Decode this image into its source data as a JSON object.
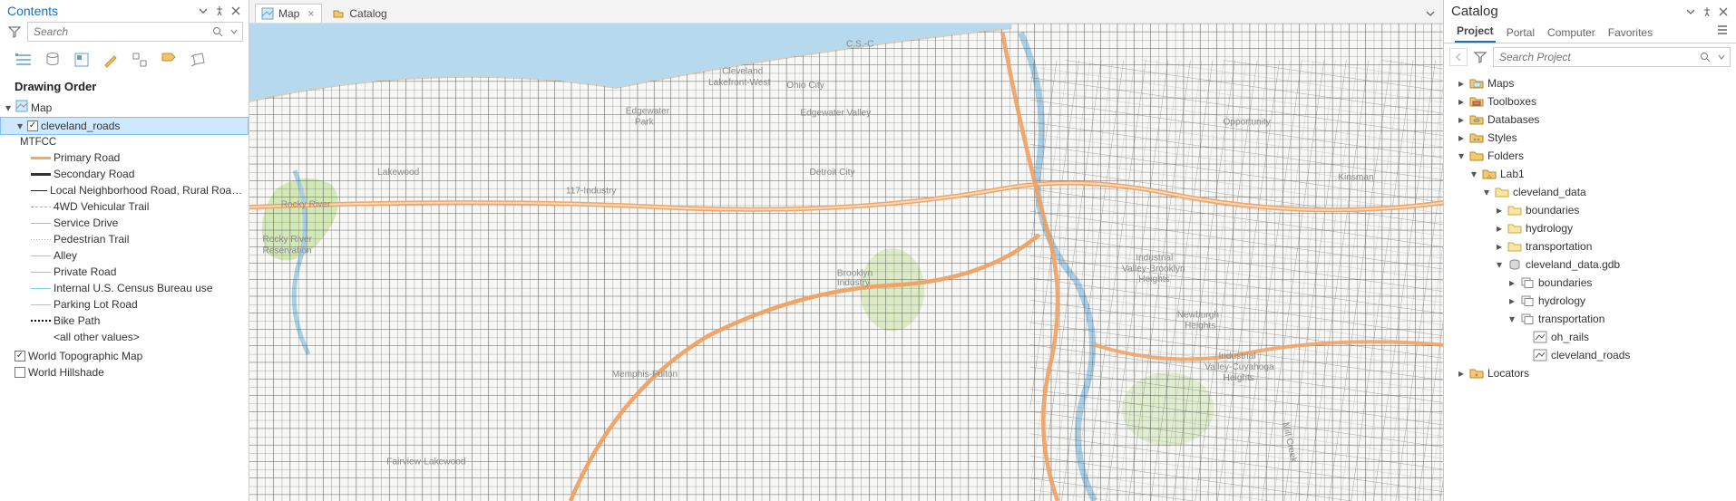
{
  "contents": {
    "title": "Contents",
    "search_placeholder": "Search",
    "section_title": "Drawing Order",
    "map_label": "Map",
    "selected_layer": "cleveland_roads",
    "mtfcc_label": "MTFCC",
    "legend_items": [
      {
        "swatch": "solid-orange",
        "label": "Primary Road"
      },
      {
        "swatch": "solid-dark",
        "label": "Secondary Road"
      },
      {
        "swatch": "thin-dark",
        "label": "Local Neighborhood Road, Rural Road, City Str..."
      },
      {
        "swatch": "dash-gray",
        "label": "4WD Vehicular Trail"
      },
      {
        "swatch": "thin-gray",
        "label": "Service Drive"
      },
      {
        "swatch": "dot-gray",
        "label": "Pedestrian Trail"
      },
      {
        "swatch": "thin-gray",
        "label": "Alley"
      },
      {
        "swatch": "thin-gray",
        "label": "Private Road"
      },
      {
        "swatch": "cyan",
        "label": "Internal U.S. Census Bureau use"
      },
      {
        "swatch": "thin-gray",
        "label": "Parking Lot Road"
      },
      {
        "swatch": "dark-dot",
        "label": "Bike Path"
      }
    ],
    "all_other_values": "<all other values>",
    "basemap_topographic": "World Topographic Map",
    "basemap_hillshade": "World Hillshade"
  },
  "view_tabs": {
    "map_label": "Map",
    "catalog_label": "Catalog"
  },
  "catalog": {
    "title": "Catalog",
    "tabs": {
      "project": "Project",
      "portal": "Portal",
      "computer": "Computer",
      "favorites": "Favorites"
    },
    "search_placeholder": "Search Project",
    "nodes": {
      "maps": "Maps",
      "toolboxes": "Toolboxes",
      "databases": "Databases",
      "styles": "Styles",
      "folders": "Folders",
      "lab1": "Lab1",
      "cleveland_data": "cleveland_data",
      "boundaries": "boundaries",
      "hydrology": "hydrology",
      "transportation": "transportation",
      "cleveland_gdb": "cleveland_data.gdb",
      "gdb_boundaries": "boundaries",
      "gdb_hydrology": "hydrology",
      "gdb_transportation": "transportation",
      "oh_rails": "oh_rails",
      "cleveland_roads": "cleveland_roads",
      "locators": "Locators"
    }
  }
}
